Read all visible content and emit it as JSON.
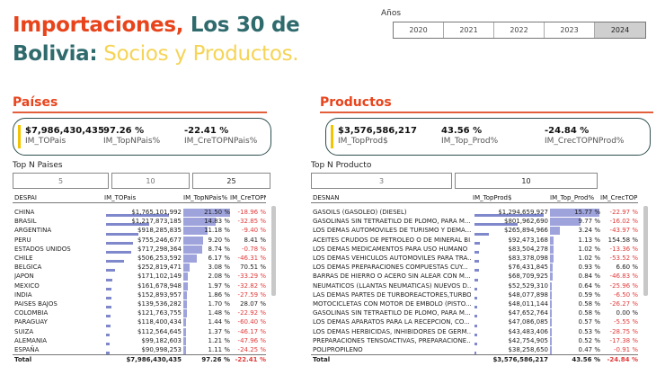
{
  "title": {
    "part1": "Importaciones,",
    "part2": " Los 30 de",
    "part3": "Bolivia:",
    "part4": " Socios y Productos."
  },
  "years": {
    "label": "Años",
    "options": [
      "2020",
      "2021",
      "2022",
      "2023",
      "2024"
    ],
    "selected": "2024"
  },
  "paises": {
    "heading": "Países",
    "kpi": [
      {
        "value": "$7,986,430,435",
        "label": "IM_TOPais"
      },
      {
        "value": "97.26 %",
        "label": "IM_TopNPais%"
      },
      {
        "value": "-22.41 %",
        "label": "IM_CreTOPNPais%"
      }
    ],
    "topn_label": "Top N Paises",
    "topn_options": [
      "5",
      "10",
      "25"
    ],
    "topn_selected": "25",
    "columns": [
      "DESPAI",
      "IM_TOPais",
      "IM_TopNPais%",
      "IM_CreTOPNPais%"
    ],
    "rows": [
      {
        "name": "CHINA",
        "v": "$1,765,101,992",
        "p": "21.50 %",
        "pv": 21.5,
        "vv": 1765.1,
        "g": "-18.96 %",
        "neg": true
      },
      {
        "name": "BRASIL",
        "v": "$1,217,873,185",
        "p": "14.83 %",
        "pv": 14.83,
        "vv": 1217.9,
        "g": "-32.85 %",
        "neg": true
      },
      {
        "name": "ARGENTINA",
        "v": "$918,285,835",
        "p": "11.18 %",
        "pv": 11.18,
        "vv": 918.3,
        "g": "-9.40 %",
        "neg": true
      },
      {
        "name": "PERU",
        "v": "$755,246,677",
        "p": "9.20 %",
        "pv": 9.2,
        "vv": 755.2,
        "g": "8.41 %",
        "neg": false
      },
      {
        "name": "ESTADOS UNIDOS",
        "v": "$717,298,364",
        "p": "8.74 %",
        "pv": 8.74,
        "vv": 717.3,
        "g": "-0.78 %",
        "neg": true
      },
      {
        "name": "CHILE",
        "v": "$506,253,592",
        "p": "6.17 %",
        "pv": 6.17,
        "vv": 506.3,
        "g": "-46.31 %",
        "neg": true
      },
      {
        "name": "BELGICA",
        "v": "$252,819,471",
        "p": "3.08 %",
        "pv": 3.08,
        "vv": 252.8,
        "g": "70.51 %",
        "neg": false
      },
      {
        "name": "JAPON",
        "v": "$171,102,149",
        "p": "2.08 %",
        "pv": 2.08,
        "vv": 171.1,
        "g": "-33.29 %",
        "neg": true
      },
      {
        "name": "MEXICO",
        "v": "$161,678,948",
        "p": "1.97 %",
        "pv": 1.97,
        "vv": 161.7,
        "g": "-32.82 %",
        "neg": true
      },
      {
        "name": "INDIA",
        "v": "$152,893,957",
        "p": "1.86 %",
        "pv": 1.86,
        "vv": 152.9,
        "g": "-27.59 %",
        "neg": true
      },
      {
        "name": "PAISES BAJOS",
        "v": "$139,536,282",
        "p": "1.70 %",
        "pv": 1.7,
        "vv": 139.5,
        "g": "28.07 %",
        "neg": false
      },
      {
        "name": "COLOMBIA",
        "v": "$121,763,755",
        "p": "1.48 %",
        "pv": 1.48,
        "vv": 121.8,
        "g": "-22.92 %",
        "neg": true
      },
      {
        "name": "PARAGUAY",
        "v": "$118,400,434",
        "p": "1.44 %",
        "pv": 1.44,
        "vv": 118.4,
        "g": "-60.40 %",
        "neg": true
      },
      {
        "name": "SUIZA",
        "v": "$112,564,645",
        "p": "1.37 %",
        "pv": 1.37,
        "vv": 112.6,
        "g": "-46.17 %",
        "neg": true
      },
      {
        "name": "ALEMANIA",
        "v": "$99,182,603",
        "p": "1.21 %",
        "pv": 1.21,
        "vv": 99.2,
        "g": "-47.96 %",
        "neg": true
      },
      {
        "name": "ESPAÑA",
        "v": "$90,998,253",
        "p": "1.11 %",
        "pv": 1.11,
        "vv": 91.0,
        "g": "-24.25 %",
        "neg": true
      }
    ],
    "total": {
      "name": "Total",
      "v": "$7,986,430,435",
      "p": "97.26 %",
      "g": "-22.41 %"
    }
  },
  "productos": {
    "heading": "Productos",
    "kpi": [
      {
        "value": "$3,576,586,217",
        "label": "IM_TopProd$"
      },
      {
        "value": "43.56 %",
        "label": "IM_Top_Prod%"
      },
      {
        "value": "-24.84 %",
        "label": "IM_CrecTOPNProd%"
      }
    ],
    "topn_label": "Top N Producto",
    "topn_options": [
      "3",
      "10"
    ],
    "topn_selected": "10",
    "columns": [
      "DESNAN",
      "IM_TopProd$",
      "IM_Top_Prod%",
      "IM_CrecTOPNProd%"
    ],
    "rows": [
      {
        "name": "GASOILS (GASOLEO) (DIESEL)",
        "v": "$1,294,659,927",
        "p": "15.77 %",
        "pv": 15.77,
        "vv": 1294.7,
        "g": "-22.97 %",
        "neg": true
      },
      {
        "name": "GASOLINAS SIN TETRAETILO DE PLOMO, PARA M...",
        "v": "$801,962,690",
        "p": "9.77 %",
        "pv": 9.77,
        "vv": 802.0,
        "g": "-16.02 %",
        "neg": true
      },
      {
        "name": "LOS DEMAS AUTOMOVILES DE TURISMO Y DEMA...",
        "v": "$265,894,966",
        "p": "3.24 %",
        "pv": 3.24,
        "vv": 265.9,
        "g": "-43.97 %",
        "neg": true
      },
      {
        "name": "ACEITES CRUDOS DE PETROLEO O DE MINERAL BI...",
        "v": "$92,473,168",
        "p": "1.13 %",
        "pv": 1.13,
        "vv": 92.5,
        "g": "154.58 %",
        "neg": false
      },
      {
        "name": "LOS DEMAS MEDICAMENTOS PARA USO HUMANO",
        "v": "$83,504,278",
        "p": "1.02 %",
        "pv": 1.02,
        "vv": 83.5,
        "g": "-13.36 %",
        "neg": true
      },
      {
        "name": "LOS DEMAS VEHICULOS AUTOMOVILES PARA TRA...",
        "v": "$83,378,098",
        "p": "1.02 %",
        "pv": 1.02,
        "vv": 83.4,
        "g": "-53.52 %",
        "neg": true
      },
      {
        "name": "LOS DEMAS  PREPARACIONES COMPUESTAS CUY...",
        "v": "$76,431,845",
        "p": "0.93 %",
        "pv": 0.93,
        "vv": 76.4,
        "g": "6.60 %",
        "neg": false
      },
      {
        "name": "BARRAS DE HIERRO O ACERO SIN ALEAR CON M...",
        "v": "$68,709,925",
        "p": "0.84 %",
        "pv": 0.84,
        "vv": 68.7,
        "g": "-46.83 %",
        "neg": true
      },
      {
        "name": "NEUMATICOS (LLANTAS NEUMATICAS) NUEVOS D...",
        "v": "$52,529,310",
        "p": "0.64 %",
        "pv": 0.64,
        "vv": 52.5,
        "g": "-25.96 %",
        "neg": true
      },
      {
        "name": "LAS DEMAS PARTES DE TURBOREACTORES,TURBO...",
        "v": "$48,077,898",
        "p": "0.59 %",
        "pv": 0.59,
        "vv": 48.1,
        "g": "-6.50 %",
        "neg": true
      },
      {
        "name": "MOTOCICLETAS CON MOTOR DE EMBOLO (PISTO...",
        "v": "$48,011,144",
        "p": "0.58 %",
        "pv": 0.58,
        "vv": 48.0,
        "g": "-26.27 %",
        "neg": true
      },
      {
        "name": "GASOLINAS SIN TETRAETILO DE PLOMO, PARA M...",
        "v": "$47,652,764",
        "p": "0.58 %",
        "pv": 0.58,
        "vv": 47.7,
        "g": "0.00 %",
        "neg": false
      },
      {
        "name": "LOS DEMAS APARATOS PARA LA RECEPCION, CO...",
        "v": "$47,086,085",
        "p": "0.57 %",
        "pv": 0.57,
        "vv": 47.1,
        "g": "-5.55 %",
        "neg": true
      },
      {
        "name": "LOS DEMAS  HERBICIDAS, INHIBIDORES DE GERM...",
        "v": "$43,483,406",
        "p": "0.53 %",
        "pv": 0.53,
        "vv": 43.5,
        "g": "-28.75 %",
        "neg": true
      },
      {
        "name": "PREPARACIONES TENSOACTIVAS, PREPARACIONE...",
        "v": "$42,754,905",
        "p": "0.52 %",
        "pv": 0.52,
        "vv": 42.8,
        "g": "-17.38 %",
        "neg": true
      },
      {
        "name": "POLIPROPILENO",
        "v": "$38,258,650",
        "p": "0.47 %",
        "pv": 0.47,
        "vv": 38.3,
        "g": "-0.91 %",
        "neg": true
      }
    ],
    "total": {
      "name": "Total",
      "v": "$3,576,586,217",
      "p": "43.56 %",
      "g": "-24.84 %"
    }
  }
}
